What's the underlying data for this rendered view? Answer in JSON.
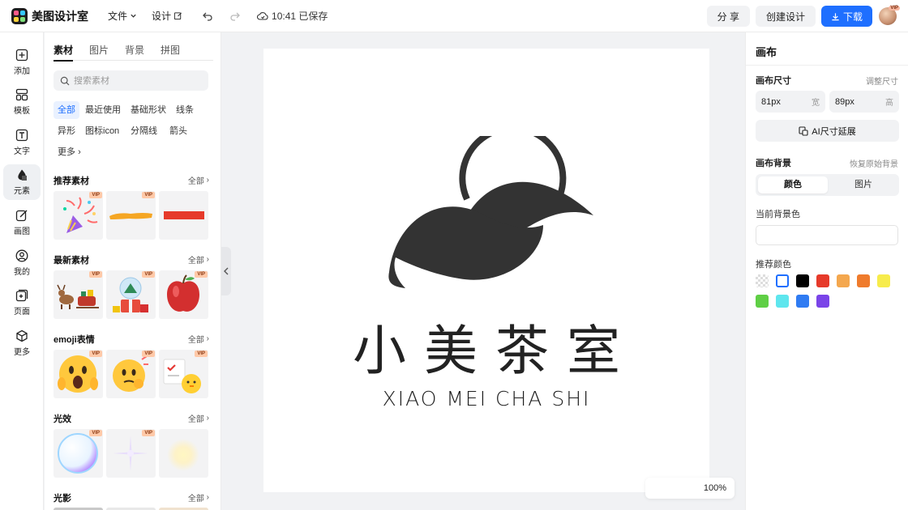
{
  "app": {
    "name": "美图设计室"
  },
  "menu": {
    "file": "文件",
    "design": "设计"
  },
  "status": {
    "saved": "10:41 已保存"
  },
  "header_buttons": {
    "share": "分 享",
    "create": "创建设计",
    "download": "下载"
  },
  "avatar_badge": "VIP",
  "rail": [
    {
      "label": "添加",
      "icon": "plus-square-icon"
    },
    {
      "label": "模板",
      "icon": "template-icon"
    },
    {
      "label": "文字",
      "icon": "text-icon"
    },
    {
      "label": "元素",
      "icon": "shapes-icon",
      "active": true
    },
    {
      "label": "画图",
      "icon": "draw-icon"
    },
    {
      "label": "我的",
      "icon": "user-icon"
    },
    {
      "label": "页面",
      "icon": "page-icon"
    },
    {
      "label": "更多",
      "icon": "cube-icon"
    }
  ],
  "panel": {
    "tabs": [
      "素材",
      "图片",
      "背景",
      "拼图"
    ],
    "search_placeholder": "搜索素材",
    "chips": [
      "全部",
      "最近使用",
      "基础形状",
      "线条",
      "异形",
      "图标icon",
      "分隔线",
      "箭头",
      "更多"
    ],
    "all_label": "全部",
    "vip": "VIP",
    "sections": [
      {
        "title": "推荐素材"
      },
      {
        "title": "最新素材"
      },
      {
        "title": "emoji表情"
      },
      {
        "title": "光效"
      },
      {
        "title": "光影"
      }
    ]
  },
  "canvas": {
    "brand_cn": "小美茶室",
    "brand_en": "XIAO MEI CHA SHI",
    "zoom": "100%"
  },
  "right_panel": {
    "title": "画布",
    "size_label": "画布尺寸",
    "adjust_size": "调整尺寸",
    "width_value": "81px",
    "width_unit": "宽",
    "height_value": "89px",
    "height_unit": "高",
    "ai_extend": "AI尺寸延展",
    "bg_label": "画布背景",
    "restore_bg": "恢复原始背景",
    "seg_color": "颜色",
    "seg_image": "图片",
    "current_bg": "当前背景色",
    "recommended": "推荐颜色",
    "swatches": [
      "transparent",
      "#ffffff",
      "#000000",
      "#e63a2a",
      "#f4a74e",
      "#ef7b2c",
      "#f7ec4b",
      "#5fcf45",
      "#5ee6ee",
      "#2f7bf2",
      "#7a44e8"
    ]
  }
}
